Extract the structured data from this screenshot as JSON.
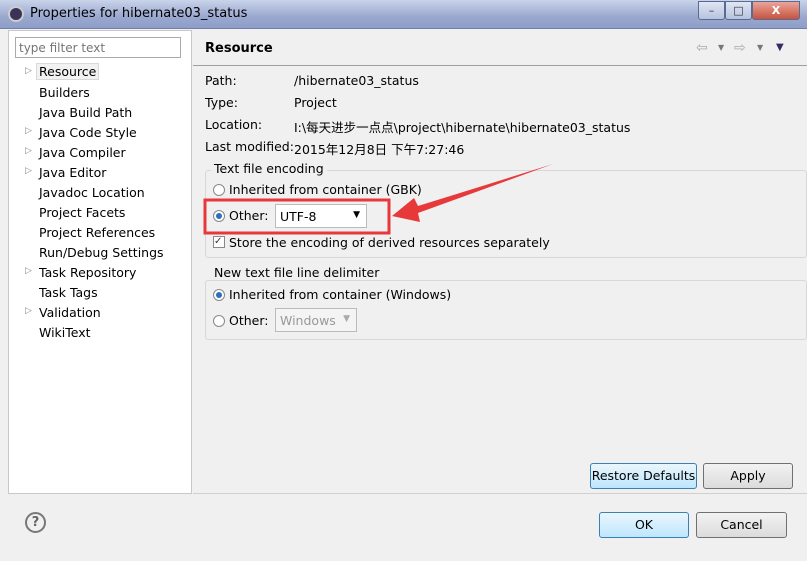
{
  "window": {
    "title": "Properties for hibernate03_status",
    "minimize": "–",
    "maximize": "□",
    "close": "X"
  },
  "filter": {
    "placeholder": "type filter text"
  },
  "tree": [
    {
      "label": "Resource",
      "expandable": true,
      "selected": true
    },
    {
      "label": "Builders",
      "expandable": false
    },
    {
      "label": "Java Build Path",
      "expandable": false
    },
    {
      "label": "Java Code Style",
      "expandable": true
    },
    {
      "label": "Java Compiler",
      "expandable": true
    },
    {
      "label": "Java Editor",
      "expandable": true
    },
    {
      "label": "Javadoc Location",
      "expandable": false
    },
    {
      "label": "Project Facets",
      "expandable": false
    },
    {
      "label": "Project References",
      "expandable": false
    },
    {
      "label": "Run/Debug Settings",
      "expandable": false
    },
    {
      "label": "Task Repository",
      "expandable": true
    },
    {
      "label": "Task Tags",
      "expandable": false
    },
    {
      "label": "Validation",
      "expandable": true
    },
    {
      "label": "WikiText",
      "expandable": false
    }
  ],
  "page": {
    "title": "Resource",
    "info": [
      {
        "label": "Path:",
        "value": "/hibernate03_status"
      },
      {
        "label": "Type:",
        "value": "Project"
      },
      {
        "label": "Location:",
        "value": "I:\\每天进步一点点\\project\\hibernate\\hibernate03_status"
      },
      {
        "label": "Last modified:",
        "value": "2015年12月8日 下午7:27:46"
      }
    ],
    "encoding": {
      "group": "Text file encoding",
      "inherited": "Inherited from container (GBK)",
      "other": "Other:",
      "value": "UTF-8",
      "selected": "other",
      "store": "Store the encoding of derived resources separately",
      "store_checked": true
    },
    "delimiter": {
      "group": "New text file line delimiter",
      "inherited": "Inherited from container (Windows)",
      "other": "Other:",
      "value": "Windows",
      "selected": "inherited"
    }
  },
  "buttons": {
    "restore": "Restore Defaults",
    "apply": "Apply",
    "ok": "OK",
    "cancel": "Cancel",
    "help": "?"
  },
  "colors": {
    "annotation": "#e8393a"
  }
}
